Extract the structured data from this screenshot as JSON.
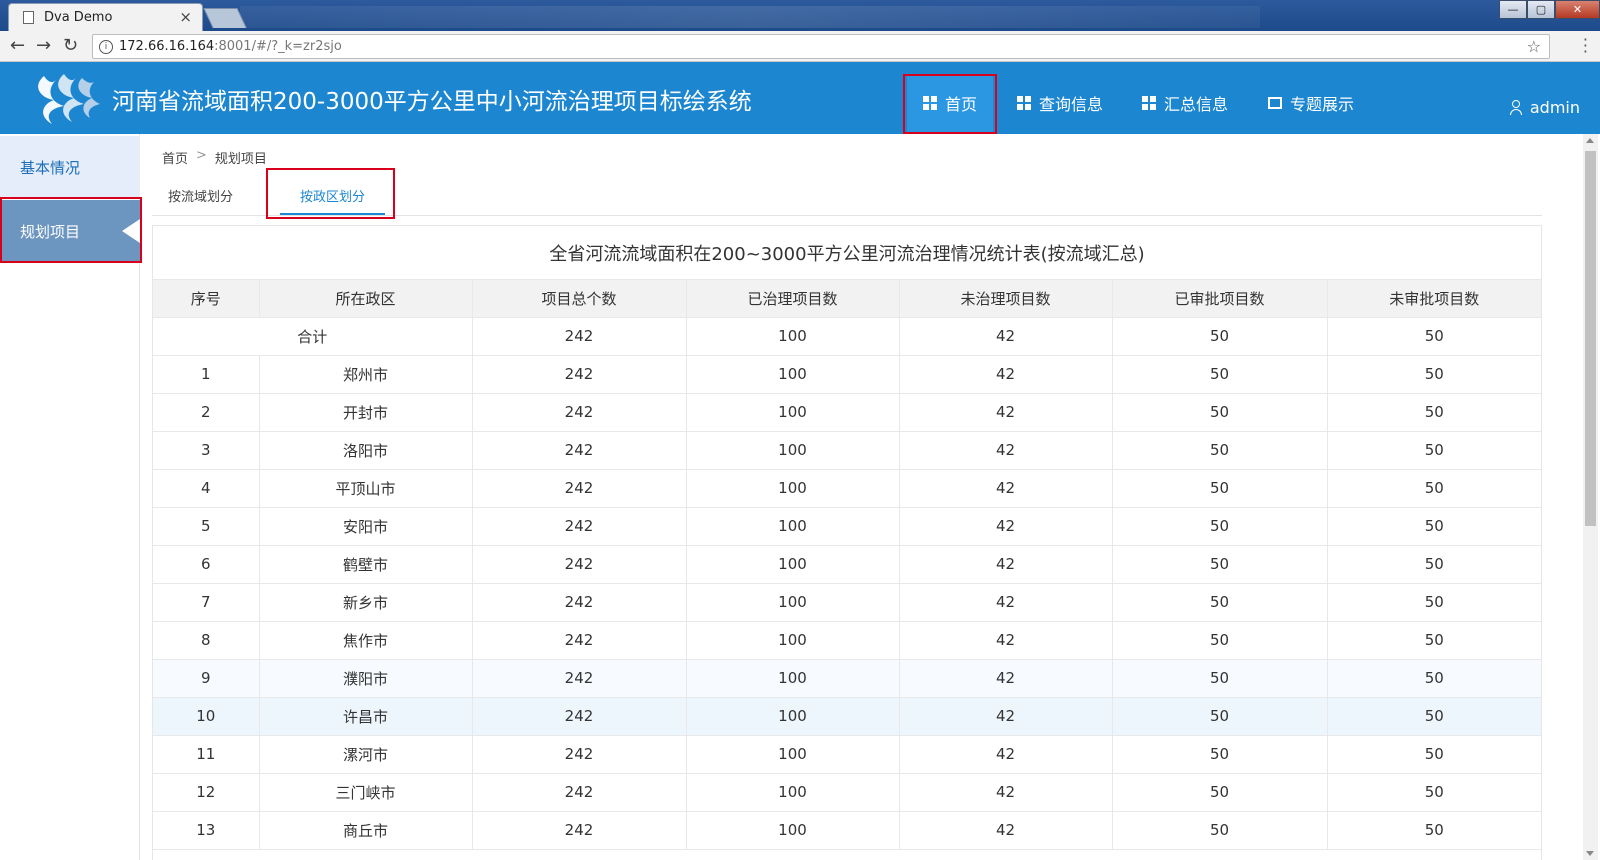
{
  "browser": {
    "tab_title": "Dva Demo",
    "tab_close": "×",
    "url_host": "172.66.16.164",
    "url_rest": ":8001/#/?_k=zr2sjo",
    "window_controls": [
      "—",
      "▢",
      "✕"
    ]
  },
  "header": {
    "title": "河南省流域面积200-3000平方公里中小河流治理项目标绘系统",
    "nav": [
      {
        "label": "首页",
        "icon": "grid-icon",
        "active": true
      },
      {
        "label": "查询信息",
        "icon": "grid-icon"
      },
      {
        "label": "汇总信息",
        "icon": "grid-icon"
      },
      {
        "label": "专题展示",
        "icon": "screen-icon"
      }
    ],
    "user": "admin"
  },
  "sidebar": {
    "items": [
      {
        "label": "基本情况"
      },
      {
        "label": "规划项目",
        "active": true
      }
    ]
  },
  "breadcrumb": {
    "home": "首页",
    "sep": ">",
    "current": "规划项目"
  },
  "subtabs": [
    {
      "label": "按流域划分"
    },
    {
      "label": "按政区划分",
      "active": true
    }
  ],
  "table": {
    "title": "全省河流流域面积在200~3000平方公里河流治理情况统计表(按流域汇总)",
    "headers": [
      "序号",
      "所在政区",
      "项目总个数",
      "已治理项目数",
      "未治理项目数",
      "已审批项目数",
      "未审批项目数"
    ],
    "total_row": {
      "label": "合计",
      "values": [
        "242",
        "100",
        "42",
        "50",
        "50"
      ]
    },
    "rows": [
      [
        "1",
        "郑州市",
        "242",
        "100",
        "42",
        "50",
        "50"
      ],
      [
        "2",
        "开封市",
        "242",
        "100",
        "42",
        "50",
        "50"
      ],
      [
        "3",
        "洛阳市",
        "242",
        "100",
        "42",
        "50",
        "50"
      ],
      [
        "4",
        "平顶山市",
        "242",
        "100",
        "42",
        "50",
        "50"
      ],
      [
        "5",
        "安阳市",
        "242",
        "100",
        "42",
        "50",
        "50"
      ],
      [
        "6",
        "鹤壁市",
        "242",
        "100",
        "42",
        "50",
        "50"
      ],
      [
        "7",
        "新乡市",
        "242",
        "100",
        "42",
        "50",
        "50"
      ],
      [
        "8",
        "焦作市",
        "242",
        "100",
        "42",
        "50",
        "50"
      ],
      [
        "9",
        "濮阳市",
        "242",
        "100",
        "42",
        "50",
        "50"
      ],
      [
        "10",
        "许昌市",
        "242",
        "100",
        "42",
        "50",
        "50"
      ],
      [
        "11",
        "漯河市",
        "242",
        "100",
        "42",
        "50",
        "50"
      ],
      [
        "12",
        "三门峡市",
        "242",
        "100",
        "42",
        "50",
        "50"
      ],
      [
        "13",
        "商丘市",
        "242",
        "100",
        "42",
        "50",
        "50"
      ]
    ]
  },
  "colors": {
    "header_bg": "#1c86d0",
    "nav_active_bg": "#2b97e3",
    "sidebar_active_bg": "#6c95bf",
    "highlight_border": "#d9001b"
  }
}
